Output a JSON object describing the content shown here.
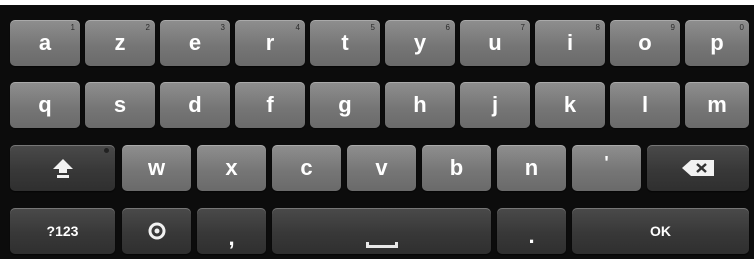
{
  "keyboard": {
    "row1": [
      {
        "label": "a",
        "sub": "1"
      },
      {
        "label": "z",
        "sub": "2"
      },
      {
        "label": "e",
        "sub": "3"
      },
      {
        "label": "r",
        "sub": "4"
      },
      {
        "label": "t",
        "sub": "5"
      },
      {
        "label": "y",
        "sub": "6"
      },
      {
        "label": "u",
        "sub": "7"
      },
      {
        "label": "i",
        "sub": "8"
      },
      {
        "label": "o",
        "sub": "9"
      },
      {
        "label": "p",
        "sub": "0"
      }
    ],
    "row2": [
      {
        "label": "q"
      },
      {
        "label": "s"
      },
      {
        "label": "d"
      },
      {
        "label": "f"
      },
      {
        "label": "g"
      },
      {
        "label": "h"
      },
      {
        "label": "j"
      },
      {
        "label": "k"
      },
      {
        "label": "l"
      },
      {
        "label": "m"
      }
    ],
    "row3": [
      {
        "label": "w"
      },
      {
        "label": "x"
      },
      {
        "label": "c"
      },
      {
        "label": "v"
      },
      {
        "label": "b"
      },
      {
        "label": "n"
      },
      {
        "label": "'"
      }
    ],
    "row4": {
      "symbols_label": "?123",
      "comma_label": ",",
      "period_label": ".",
      "ok_label": "OK"
    },
    "icons": {
      "shift": "shift-arrow-icon",
      "backspace": "backspace-icon",
      "settings": "settings-circle-icon",
      "space": "space-bar-icon"
    },
    "colors": {
      "background": "#0c0c0c",
      "key_light": "#7a7a7a",
      "key_dark": "#3a3a3a",
      "text": "#ffffff"
    }
  }
}
